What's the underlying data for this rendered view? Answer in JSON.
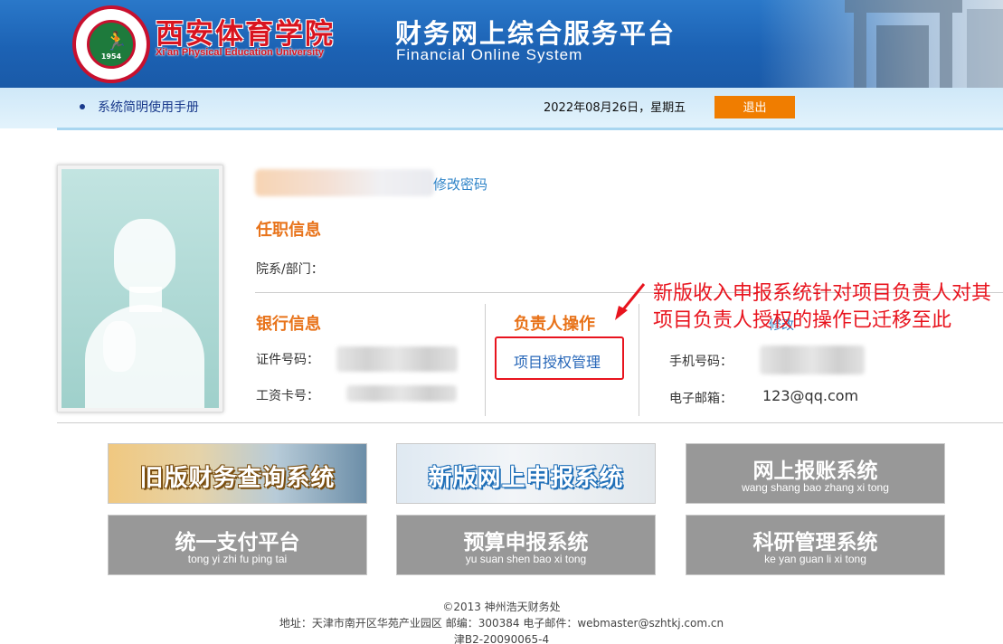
{
  "header": {
    "school_name_cn": "西安体育学院",
    "school_name_en": "Xi'an Physical Education University",
    "logo_year": "1954",
    "platform_title_cn": "财务网上综合服务平台",
    "platform_title_en": "Financial Online System"
  },
  "nav": {
    "manual_link": "系统简明使用手册",
    "date": "2022年08月26日，星期五",
    "logout_label": "退出"
  },
  "user": {
    "change_password_link": "修改密码"
  },
  "job_info": {
    "title": "任职信息",
    "department_label": "院系/部门："
  },
  "bank_info": {
    "title": "银行信息",
    "id_label": "证件号码：",
    "salary_card_label": "工资卡号："
  },
  "manager_ops": {
    "title": "负责人操作",
    "project_auth_link": "项目授权管理"
  },
  "contact": {
    "modify_link": "修改",
    "phone_label": "手机号码：",
    "email_label": "电子邮箱：",
    "email_value": "123@qq.com"
  },
  "annotation": "新版收入申报系统针对项目负责人对其项目负责人授权的操作已迁移至此",
  "modules": [
    {
      "name_cn": "旧版财务查询系统",
      "pinyin": ""
    },
    {
      "name_cn": "新版网上申报系统",
      "pinyin": ""
    },
    {
      "name_cn": "网上报账系统",
      "pinyin": "wang shang bao zhang xi tong"
    },
    {
      "name_cn": "统一支付平台",
      "pinyin": "tong yi zhi fu ping tai"
    },
    {
      "name_cn": "预算申报系统",
      "pinyin": "yu suan shen bao xi tong"
    },
    {
      "name_cn": "科研管理系统",
      "pinyin": "ke yan guan li xi tong"
    }
  ],
  "footer": {
    "copyright": "©2013 神州浩天财务处",
    "address": "地址：天津市南开区华苑产业园区 邮编：300384 电子邮件：webmaster@szhtkj.com.cn",
    "license": "津B2-20090065-4"
  },
  "colors": {
    "header_blue": "#1c62b4",
    "accent_orange": "#e8731a",
    "logout_orange": "#f07d00",
    "annotation_red": "#e8141e",
    "link_blue": "#2f84c8",
    "module_gray": "#989898"
  }
}
